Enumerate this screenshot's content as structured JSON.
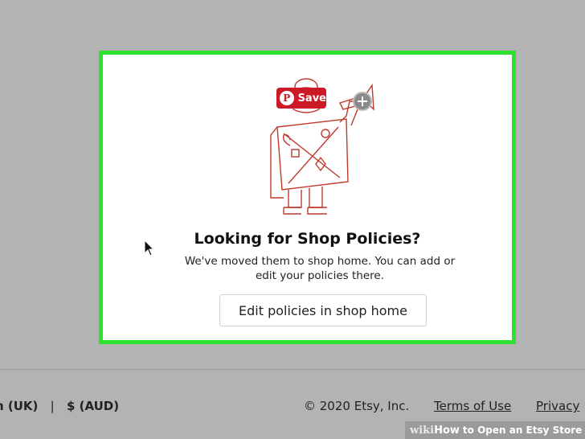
{
  "modal": {
    "title": "Looking for Shop Policies?",
    "body": "We've moved them to shop home. You can add or edit your policies there.",
    "button_label": "Edit policies in shop home",
    "highlight_color": "#2ee12e"
  },
  "pinterest": {
    "save_label": "Save",
    "logo_letter": "P",
    "color": "#cb1a25"
  },
  "footer": {
    "locale_text": "h (UK)",
    "separator": "|",
    "currency_text": "$ (AUD)",
    "copyright": "© 2020 Etsy, Inc.",
    "terms_link": "Terms of Use",
    "privacy_link": "Privacy",
    "cut_link": "I"
  },
  "watermark": {
    "wiki": "wiki",
    "how": "How",
    "rest": "to Open an Etsy Store"
  },
  "icons": {
    "illustration": "town-crier-illustration-icon",
    "zoom": "zoom-plus-icon",
    "cursor": "mouse-pointer-icon"
  }
}
